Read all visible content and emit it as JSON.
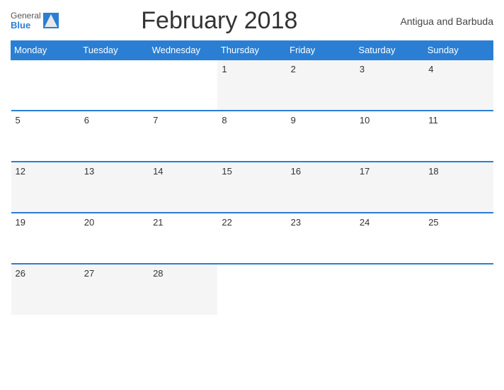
{
  "header": {
    "title": "February 2018",
    "country": "Antigua and Barbuda",
    "logo_general": "General",
    "logo_blue": "Blue"
  },
  "days_of_week": [
    "Monday",
    "Tuesday",
    "Wednesday",
    "Thursday",
    "Friday",
    "Saturday",
    "Sunday"
  ],
  "weeks": [
    [
      null,
      null,
      null,
      1,
      2,
      3,
      4
    ],
    [
      5,
      6,
      7,
      8,
      9,
      10,
      11
    ],
    [
      12,
      13,
      14,
      15,
      16,
      17,
      18
    ],
    [
      19,
      20,
      21,
      22,
      23,
      24,
      25
    ],
    [
      26,
      27,
      28,
      null,
      null,
      null,
      null
    ]
  ],
  "colors": {
    "header_bg": "#2a7fd4",
    "header_text": "#ffffff",
    "row_alt": "#f5f5f5",
    "border": "#2a7fd4"
  }
}
